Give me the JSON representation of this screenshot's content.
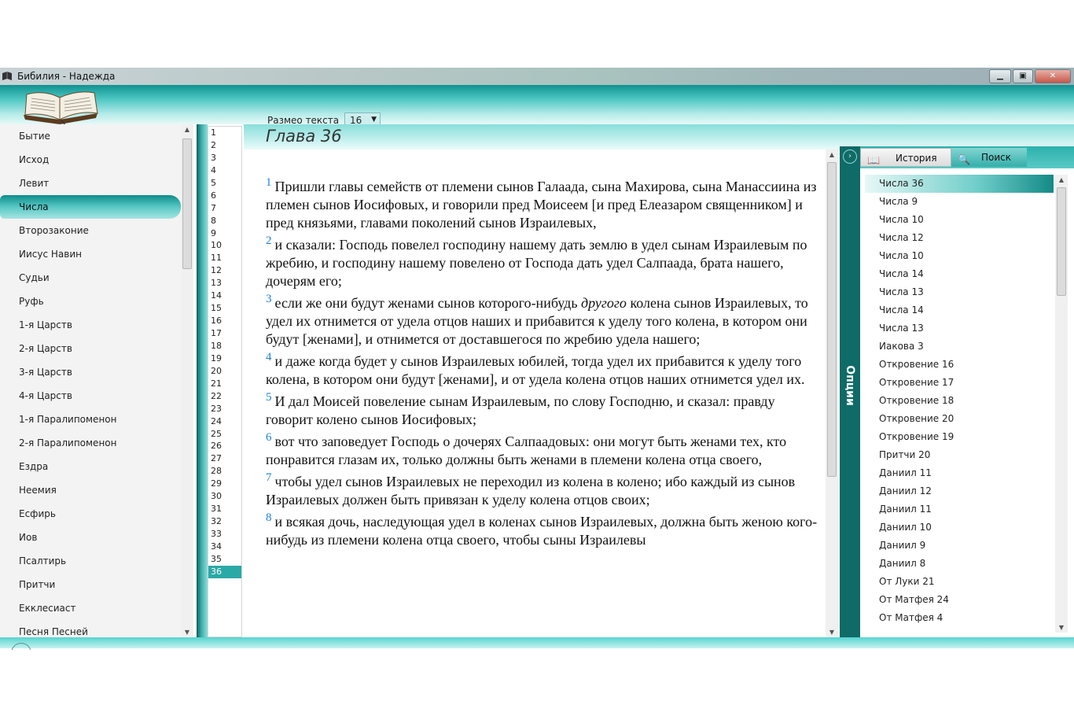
{
  "window": {
    "title": "Бибилия - Надежда",
    "buttons": [
      "minimize",
      "maximize",
      "close"
    ]
  },
  "toolbar": {
    "size_label": "Размео текста",
    "size_value": "16"
  },
  "books": [
    "Бытие",
    "Исход",
    "Левит",
    "Числа",
    "Второзаконие",
    "Иисус Навин",
    "Судьи",
    "Руфь",
    "1-я Царств",
    "2-я Царств",
    "3-я Царств",
    "4-я Царств",
    "1-я Паралипоменон",
    "2-я Паралипоменон",
    "Ездра",
    "Неемия",
    "Есфирь",
    "Иов",
    "Псалтирь",
    "Притчи",
    "Екклесиаст",
    "Песня Песней"
  ],
  "selected_book": "Числа",
  "chapters": [
    "1",
    "2",
    "3",
    "4",
    "5",
    "6",
    "7",
    "8",
    "9",
    "10",
    "11",
    "12",
    "13",
    "14",
    "15",
    "16",
    "17",
    "18",
    "19",
    "20",
    "21",
    "22",
    "23",
    "24",
    "25",
    "26",
    "27",
    "28",
    "29",
    "30",
    "31",
    "32",
    "33",
    "34",
    "35",
    "36"
  ],
  "selected_chapter": "36",
  "chapter_title": "Глава 36",
  "verses": [
    {
      "num": "1",
      "text": "Пришли главы семейств от племени сынов Галаада, сына Махирова, сына Манассиина из племен сынов Иосифовых, и говорили пред Моисеем [и пред Елеазаром священником] и пред князьями, главами поколений сынов Израилевых,"
    },
    {
      "num": "2",
      "text": "и сказали: Господь повелел господину нашему дать землю в удел сынам Израилевым по жребию, и господину нашему повелено от Господа дать удел Салпаада, брата нашего, дочерям его;"
    },
    {
      "num": "3",
      "pre": "если же они будут женами сынов которого-нибудь ",
      "em": "другого",
      "post": " колена сынов Израилевых, то удел их отнимется от удела отцов наших и прибавится к уделу того колена, в котором они будут [женами], и отнимется от доставшегося по жребию удела нашего;"
    },
    {
      "num": "4",
      "text": "и даже когда будет у сынов Израилевых юбилей, тогда удел их прибавится к уделу того колена, в котором они будут [женами], и от удела колена отцов наших отнимется удел их."
    },
    {
      "num": "5",
      "text": "И дал Моисей повеление сынам Израилевым, по слову Господню, и сказал: правду говорит колено сынов Иосифовых;"
    },
    {
      "num": "6",
      "text": "вот что заповедует Господь о дочерях Салпаадовых: они могут быть женами тех, кто понравится глазам их, только должны быть женами в племени колена отца своего,"
    },
    {
      "num": "7",
      "text": "чтобы удел сынов Израилевых не переходил из колена в колено; ибо каждый из сынов Израилевых должен быть привязан к уделу колена отцов своих;"
    },
    {
      "num": "8",
      "text": "и всякая дочь, наследующая удел в коленах сынов Израилевых, должна быть женою кого-нибудь из племени колена отца своего, чтобы сыны Израилевы"
    }
  ],
  "options": {
    "label": "Опции",
    "tab_history": "История",
    "tab_search": "Поиск"
  },
  "history": [
    "Числа 36",
    "Числа 9",
    "Числа 10",
    "Числа 12",
    "Числа 10",
    "Числа 14",
    "Числа 13",
    "Числа 14",
    "Числа 13",
    "Иакова 3",
    "Откровение 16",
    "Откровение 17",
    "Откровение 18",
    "Откровение 20",
    "Откровение 19",
    "Притчи 20",
    "Даниил 11",
    "Даниил 12",
    "Даниил 11",
    "Даниил 10",
    "Даниил 9",
    "Даниил 8",
    "От Луки 21",
    "От Матфея 24",
    "От Матфея 4"
  ],
  "selected_history": "Числа 36",
  "colors": {
    "accent": "#2aa9a7",
    "dark_accent": "#0f6b67",
    "verse_number": "#1b7fe0"
  }
}
